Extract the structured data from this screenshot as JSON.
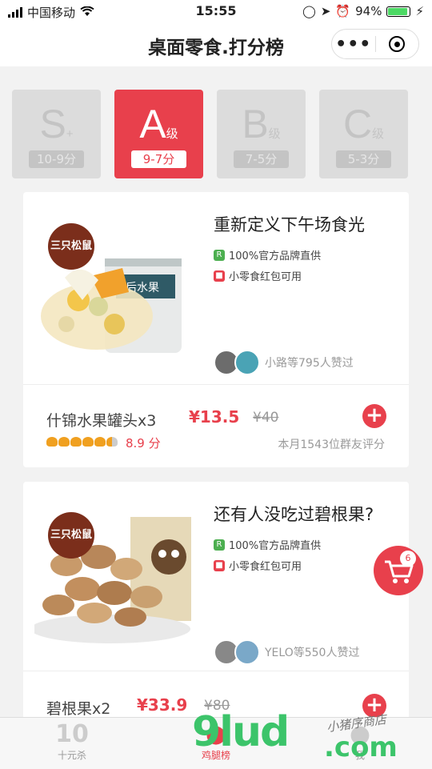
{
  "status": {
    "carrier": "中国移动",
    "time": "15:55",
    "battery": "94%"
  },
  "nav": {
    "title": "桌面零食.打分榜"
  },
  "grades": [
    {
      "letter": "S",
      "sup": "+",
      "range": "10-9分",
      "active": false
    },
    {
      "letter": "A",
      "sup": "级",
      "range": "9-7分",
      "active": true
    },
    {
      "letter": "B",
      "sup": "级",
      "range": "7-5分",
      "active": false
    },
    {
      "letter": "C",
      "sup": "级",
      "range": "5-3分",
      "active": false
    }
  ],
  "products": [
    {
      "logo": "三只松鼠",
      "headline": "重新定义下午场食光",
      "tag1": "100%官方品牌直供",
      "tag2": "小零食红包可用",
      "likes": "小路等795人赞过",
      "name": "什锦水果罐头x3",
      "price": "¥13.5",
      "old_price": "¥40",
      "rating": 4.5,
      "score": "8.9 分",
      "rate_count": "本月1543位群友评分"
    },
    {
      "logo": "三只松鼠",
      "headline": "还有人没吃过碧根果?",
      "tag1": "100%官方品牌直供",
      "tag2": "小零食红包可用",
      "likes": "YELO等550人赞过",
      "name": "碧根果x2",
      "price": "¥33.9",
      "old_price": "¥80"
    }
  ],
  "cart": {
    "count": "6"
  },
  "tabs": [
    {
      "icon": "10",
      "label": "十元杀"
    },
    {
      "icon": "",
      "label": "鸡腿榜"
    },
    {
      "icon": "",
      "label": "我"
    }
  ],
  "watermark": {
    "main": "9lud",
    "suffix": ".com",
    "script": "小猪序商店"
  },
  "colors": {
    "accent": "#e8404c",
    "tag_green": "#4caf50"
  }
}
